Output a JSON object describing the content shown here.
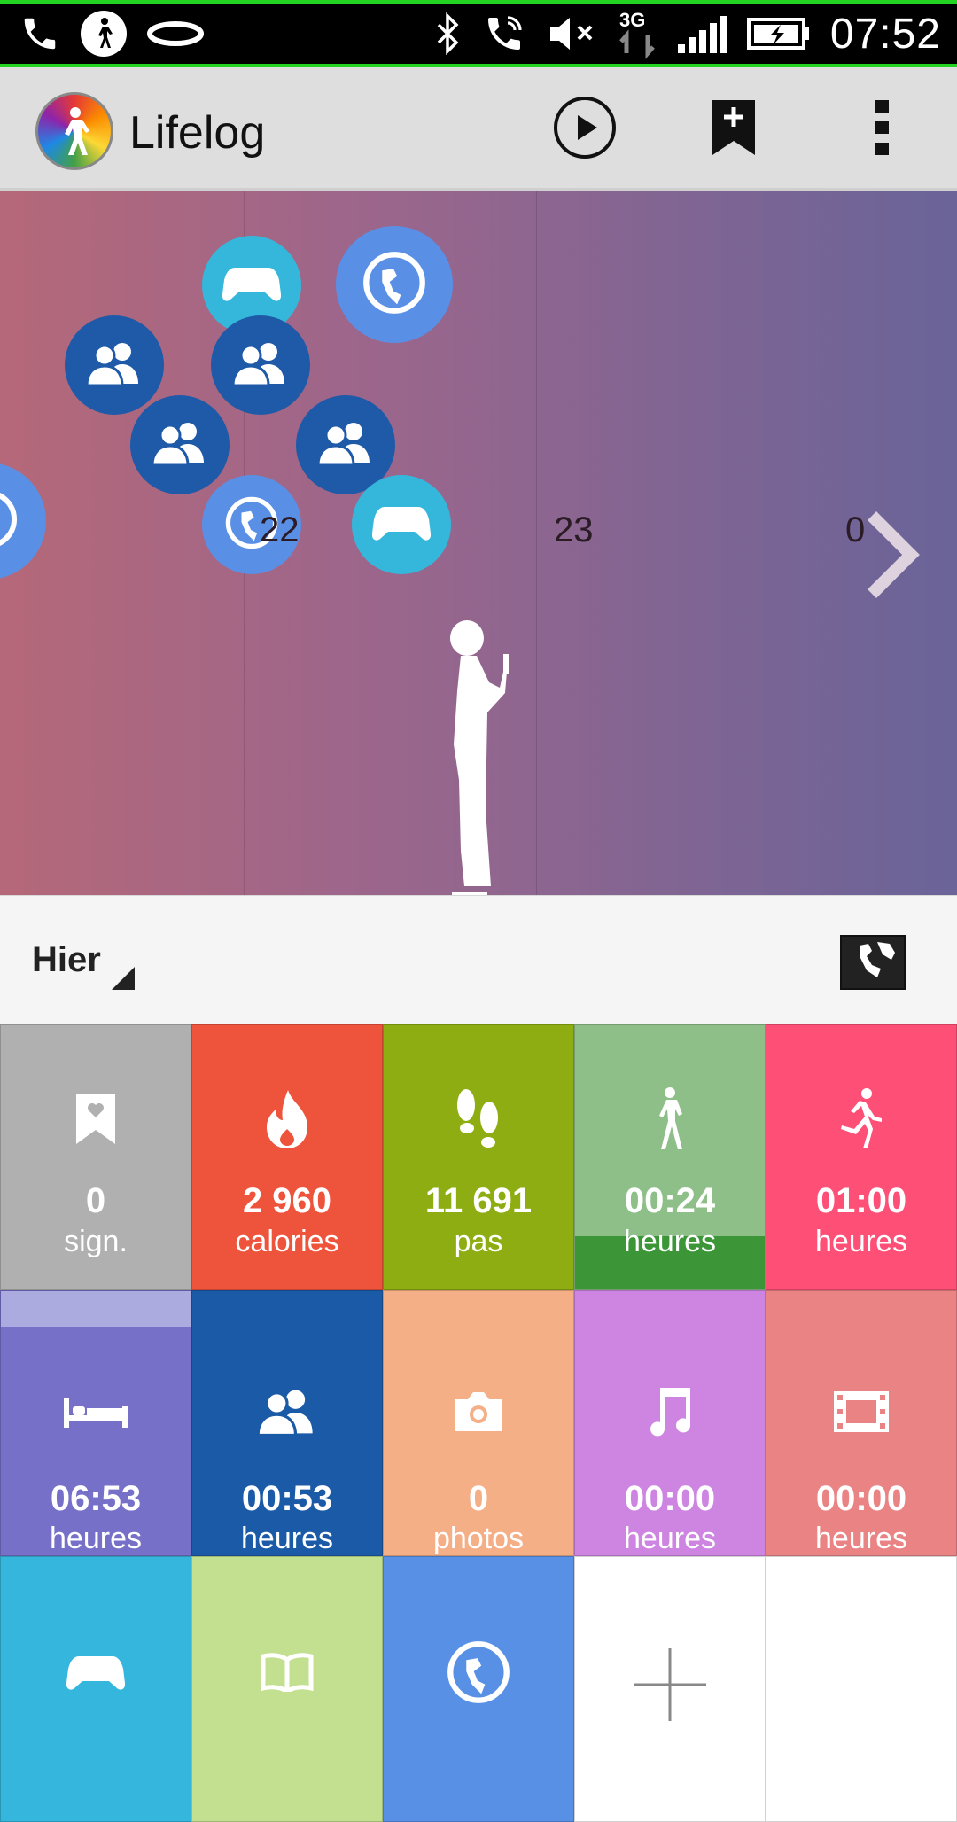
{
  "status_bar": {
    "time": "07:52",
    "network": "3G",
    "icons": [
      "phone-icon",
      "lifelog-walk-icon",
      "smartband-icon",
      "bluetooth-icon",
      "call-forward-icon",
      "mute-icon",
      "data-arrows-icon",
      "signal-icon",
      "battery-charging-icon"
    ]
  },
  "action_bar": {
    "title": "Lifelog",
    "actions": [
      "play-icon",
      "bookmark-add-icon",
      "overflow-menu-icon"
    ]
  },
  "timeline": {
    "day_labels": [
      "22",
      "23",
      "0"
    ],
    "bubbles": [
      "friends",
      "friends",
      "friends",
      "friends",
      "game",
      "game",
      "web",
      "web",
      "web"
    ]
  },
  "date_selector": {
    "label": "Hier"
  },
  "tiles": [
    {
      "icon": "bookmark-heart-icon",
      "value": "0",
      "unit": "sign.",
      "color": "#b0b0b0"
    },
    {
      "icon": "flame-icon",
      "value": "2 960",
      "unit": "calories",
      "color": "#ee533b"
    },
    {
      "icon": "footsteps-icon",
      "value": "11 691",
      "unit": "pas",
      "color": "#8dad12"
    },
    {
      "icon": "walking-icon",
      "value": "00:24",
      "unit": "heures",
      "color": "#8fbf89",
      "progress_color": "#3c9638"
    },
    {
      "icon": "running-icon",
      "value": "01:00",
      "unit": "heures",
      "color": "#fe4f77"
    },
    {
      "icon": "bed-icon",
      "value": "06:53",
      "unit": "heures",
      "color": "#7670c9",
      "progress_color": "#ababe0"
    },
    {
      "icon": "friends-icon",
      "value": "00:53",
      "unit": "heures",
      "color": "#1b5aa6"
    },
    {
      "icon": "camera-icon",
      "value": "0",
      "unit": "photos",
      "color": "#f5af87"
    },
    {
      "icon": "music-note-icon",
      "value": "00:00",
      "unit": "heures",
      "color": "#cd85e1"
    },
    {
      "icon": "film-icon",
      "value": "00:00",
      "unit": "heures",
      "color": "#ea8484"
    },
    {
      "icon": "gamepad-icon",
      "value": "",
      "unit": "",
      "color": "#35b6dc"
    },
    {
      "icon": "book-icon",
      "value": "",
      "unit": "",
      "color": "#c2e08f"
    },
    {
      "icon": "globe-icon",
      "value": "",
      "unit": "",
      "color": "#5890e6"
    },
    {
      "icon": "add-icon",
      "value": "",
      "unit": "",
      "color": "#ffffff"
    },
    {
      "icon": "",
      "value": "",
      "unit": "",
      "color": "#ffffff"
    }
  ]
}
